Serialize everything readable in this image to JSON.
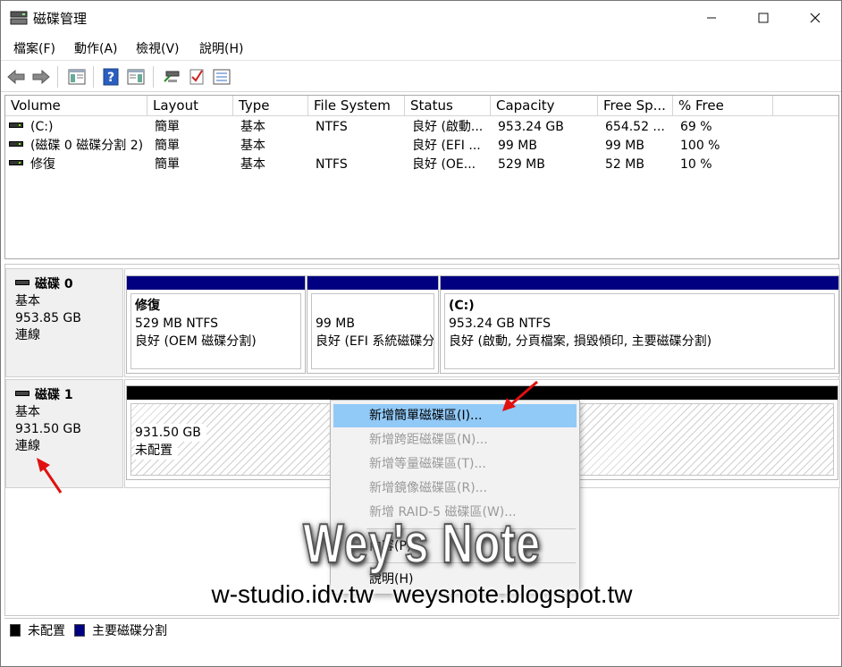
{
  "window": {
    "title": "磁碟管理",
    "controls": {
      "minimize": "—",
      "maximize": "☐",
      "close": "✕"
    }
  },
  "menu": [
    "檔案(F)",
    "動作(A)",
    "檢視(V)",
    "說明(H)"
  ],
  "toolbar": {
    "icons": [
      "back-arrow-icon",
      "forward-arrow-icon",
      "console-tree-icon",
      "help-icon",
      "properties-icon",
      "connect-icon",
      "check-icon",
      "list-icon"
    ]
  },
  "volume_list": {
    "columns": [
      "Volume",
      "Layout",
      "Type",
      "File System",
      "Status",
      "Capacity",
      "Free Sp...",
      "% Free"
    ],
    "rows": [
      [
        "(C:)",
        "簡單",
        "基本",
        "NTFS",
        "良好 (啟動...",
        "953.24 GB",
        "654.52 ...",
        "69 %"
      ],
      [
        "(磁碟 0 磁碟分割 2)",
        "簡單",
        "基本",
        "",
        "良好 (EFI ...",
        "99 MB",
        "99 MB",
        "100 %"
      ],
      [
        "修復",
        "簡單",
        "基本",
        "NTFS",
        "良好 (OE...",
        "529 MB",
        "52 MB",
        "10 %"
      ]
    ]
  },
  "disks": [
    {
      "name": "磁碟 0",
      "type": "基本",
      "size": "953.85 GB",
      "status": "連線",
      "partitions": [
        {
          "name": "修復",
          "size": "529 MB NTFS",
          "status": "良好 (OEM 磁碟分割)"
        },
        {
          "name": "",
          "size": "99 MB",
          "status": "良好 (EFI 系統磁碟分割)"
        },
        {
          "name": "(C:)",
          "size": "953.24 GB NTFS",
          "status": "良好 (啟動, 分頁檔案, 損毀傾印, 主要磁碟分割)"
        }
      ]
    },
    {
      "name": "磁碟 1",
      "type": "基本",
      "size": "931.50 GB",
      "status": "連線",
      "partitions": [
        {
          "size": "931.50 GB",
          "status": "未配置"
        }
      ]
    }
  ],
  "context_menu": [
    {
      "label": "新增簡單磁碟區(I)...",
      "enabled": true
    },
    {
      "label": "新增跨距磁碟區(N)...",
      "enabled": false
    },
    {
      "label": "新增等量磁碟區(T)...",
      "enabled": false
    },
    {
      "label": "新增鏡像磁碟區(R)...",
      "enabled": false
    },
    {
      "label": "新增 RAID-5 磁碟區(W)...",
      "enabled": false
    },
    {
      "label": "內容(P)",
      "enabled": true
    },
    {
      "label": "說明(H)",
      "enabled": true
    }
  ],
  "legend": [
    {
      "label": "未配置",
      "color": "#000000"
    },
    {
      "label": "主要磁碟分割",
      "color": "#000080"
    }
  ],
  "watermark": {
    "title": "Wey's Note",
    "urls": "w-studio.idv.tw weysnote.blogspot.tw"
  },
  "colors": {
    "primary_partition": "#000080",
    "unallocated": "#000000",
    "menu_highlight": "#91c9f7",
    "annotation_arrow": "#e01010"
  }
}
